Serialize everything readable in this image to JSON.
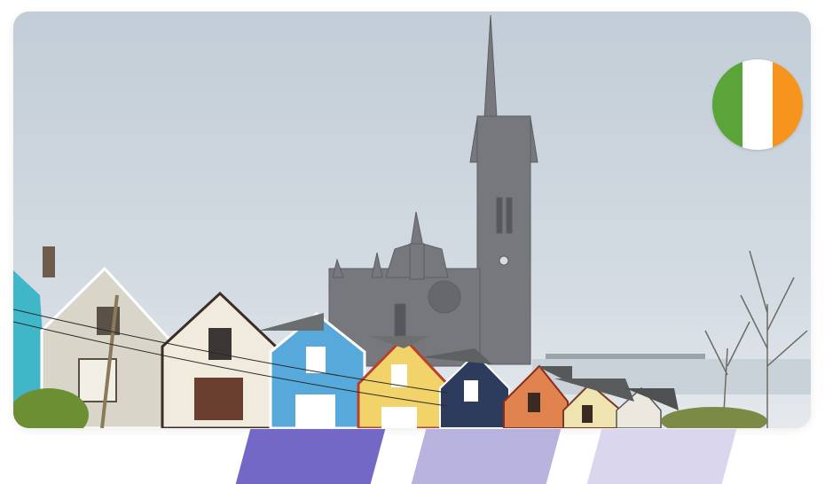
{
  "photo": {
    "subject": "cathedral-town-scene",
    "colors": {
      "sky_top": "#c3ced8",
      "sky_bottom": "#dfe5ea",
      "stone": "#7b7d82",
      "stone_dark": "#5e6066"
    }
  },
  "flag": {
    "icon": "ireland-flag-icon",
    "colors": [
      "#5aa43a",
      "#ffffff",
      "#f7941d"
    ]
  },
  "pager": {
    "segments": [
      {
        "color": "#7368c6",
        "active": true
      },
      {
        "color": "#b7b2de",
        "active": false
      },
      {
        "color": "#d9d6ee",
        "active": false
      }
    ]
  }
}
